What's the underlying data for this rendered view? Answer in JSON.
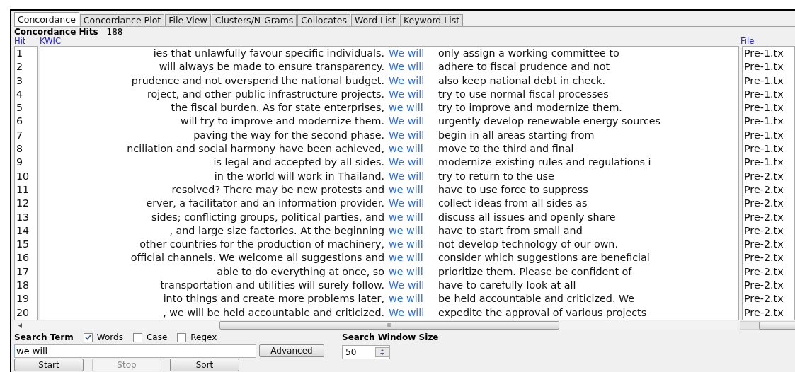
{
  "tabs": [
    {
      "label": "Concordance",
      "selected": true
    },
    {
      "label": "Concordance Plot",
      "selected": false
    },
    {
      "label": "File View",
      "selected": false
    },
    {
      "label": "Clusters/N-Grams",
      "selected": false
    },
    {
      "label": "Collocates",
      "selected": false
    },
    {
      "label": "Word List",
      "selected": false
    },
    {
      "label": "Keyword List",
      "selected": false
    }
  ],
  "hits": {
    "label": "Concordance Hits",
    "count": "188"
  },
  "columns": {
    "hit": "Hit",
    "kwic": "KWIC",
    "file": "File"
  },
  "rows": [
    {
      "hit": "1",
      "left": "ies that unlawfully favour specific individuals.",
      "key": "We will",
      "right": "only assign a working committee to",
      "file": "Pre-1.tx"
    },
    {
      "hit": "2",
      "left": "will always be made to ensure transparency.",
      "key": "We will",
      "right": "adhere to fiscal prudence and not",
      "file": "Pre-1.tx"
    },
    {
      "hit": "3",
      "left": "prudence and not overspend the national budget.",
      "key": "We will",
      "right": "also keep national debt in check.",
      "file": "Pre-1.tx"
    },
    {
      "hit": "4",
      "left": "roject, and other public infrastructure projects.",
      "key": "We will",
      "right": "try to use normal fiscal processes",
      "file": "Pre-1.tx"
    },
    {
      "hit": "5",
      "left": "the fiscal burden. As for state enterprises,",
      "key": "we will",
      "right": "try to improve and modernize them.",
      "file": "Pre-1.tx"
    },
    {
      "hit": "6",
      "left": "will try to improve and modernize them.",
      "key": "We will",
      "right": "urgently develop renewable energy sources",
      "file": "Pre-1.tx"
    },
    {
      "hit": "7",
      "left": "paving the way for the second phase.",
      "key": "We will",
      "right": "begin in all areas starting from",
      "file": "Pre-1.tx"
    },
    {
      "hit": "8",
      "left": "nciliation and social harmony have been achieved,",
      "key": "we will",
      "right": "move to the third and final",
      "file": "Pre-1.tx"
    },
    {
      "hit": "9",
      "left": "is legal and accepted by all sides.",
      "key": "We will",
      "right": "modernize existing rules and regulations i",
      "file": "Pre-1.tx"
    },
    {
      "hit": "10",
      "left": "in the world will work in Thailand.",
      "key": "We will",
      "right": "try to return to the use",
      "file": "Pre-2.tx"
    },
    {
      "hit": "11",
      "left": "resolved? There may be new protests and",
      "key": "we will",
      "right": "have to use force to suppress",
      "file": "Pre-2.tx"
    },
    {
      "hit": "12",
      "left": "erver, a facilitator and an information provider.",
      "key": "We will",
      "right": "collect ideas from all sides as",
      "file": "Pre-2.tx"
    },
    {
      "hit": "13",
      "left": "sides; conflicting groups, political parties, and",
      "key": "we will",
      "right": "discuss all issues and openly share",
      "file": "Pre-2.tx"
    },
    {
      "hit": "14",
      "left": ", and large size factories. At the beginning",
      "key": "we will",
      "right": "have to start from small and",
      "file": "Pre-2.tx"
    },
    {
      "hit": "15",
      "left": "other countries for the production of machinery,",
      "key": "we will",
      "right": "not develop technology of our own.",
      "file": "Pre-2.tx"
    },
    {
      "hit": "16",
      "left": "official channels. We welcome all suggestions and",
      "key": "we will",
      "right": "consider which suggestions are beneficial",
      "file": "Pre-2.tx"
    },
    {
      "hit": "17",
      "left": "able to do everything at once, so",
      "key": "we will",
      "right": "prioritize them. Please be confident of",
      "file": "Pre-2.tx"
    },
    {
      "hit": "18",
      "left": "transportation and utilities will surely follow.",
      "key": "We will",
      "right": "have to carefully look at all",
      "file": "Pre-2.tx"
    },
    {
      "hit": "19",
      "left": "into things and create more problems later,",
      "key": "we will",
      "right": "be held accountable and criticized. We",
      "file": "Pre-2.tx"
    },
    {
      "hit": "20",
      "left": ", we will be held accountable and criticized.",
      "key": "We will",
      "right": "expedite the approval of various projects",
      "file": "Pre-2.tx"
    }
  ],
  "search": {
    "label": "Search Term",
    "options": [
      {
        "label": "Words",
        "checked": true
      },
      {
        "label": "Case",
        "checked": false
      },
      {
        "label": "Regex",
        "checked": false
      }
    ],
    "value": "we will",
    "advanced": "Advanced"
  },
  "window_size": {
    "label": "Search Window Size",
    "value": "50"
  },
  "scroll_thumb": "III",
  "buttons": [
    {
      "label": "Start",
      "disabled": false
    },
    {
      "label": "Stop",
      "disabled": true
    },
    {
      "label": "Sort",
      "disabled": false
    }
  ]
}
